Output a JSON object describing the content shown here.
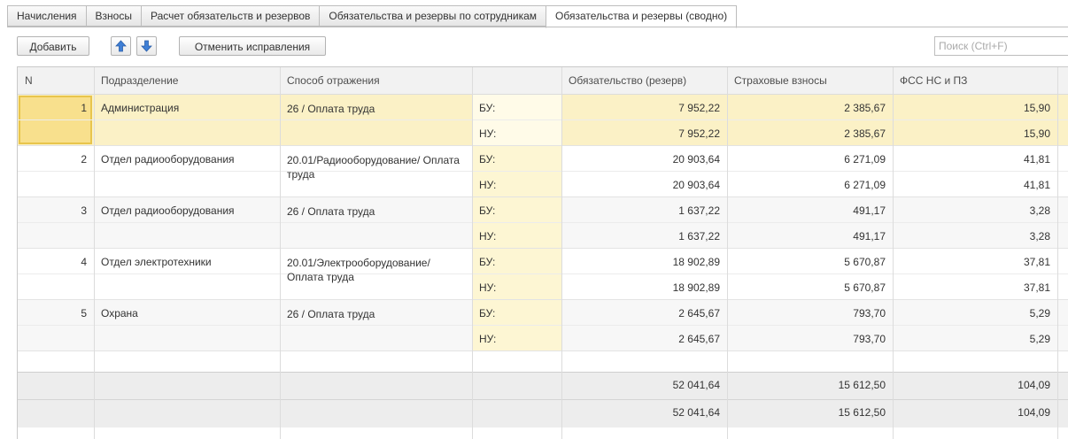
{
  "tabs": [
    {
      "label": "Начисления",
      "active": false
    },
    {
      "label": "Взносы",
      "active": false
    },
    {
      "label": "Расчет обязательств и резервов",
      "active": false
    },
    {
      "label": "Обязательства и резервы по сотрудникам",
      "active": false
    },
    {
      "label": "Обязательства и резервы (сводно)",
      "active": true
    }
  ],
  "toolbar": {
    "add_label": "Добавить",
    "cancel_label": "Отменить исправления",
    "up_icon": "arrow-up-icon",
    "down_icon": "arrow-down-icon"
  },
  "search": {
    "placeholder": "Поиск (Ctrl+F)",
    "value": ""
  },
  "table": {
    "headers": {
      "n": "N",
      "department": "Подразделение",
      "method": "Способ отражения",
      "type": "",
      "liability": "Обязательство (резерв)",
      "insurance": "Страховые взносы",
      "fss": "ФСС НС и ПЗ"
    },
    "rows": [
      {
        "n": "1",
        "department": "Администрация",
        "method": "26 / Оплата труда",
        "bu_label": "БУ:",
        "nu_label": "НУ:",
        "bu": {
          "liability": "7 952,22",
          "insurance": "2 385,67",
          "fss": "15,90"
        },
        "nu": {
          "liability": "7 952,22",
          "insurance": "2 385,67",
          "fss": "15,90"
        }
      },
      {
        "n": "2",
        "department": "Отдел радиооборудования",
        "method": "20.01/Радиооборудование/ Оплата труда",
        "bu_label": "БУ:",
        "nu_label": "НУ:",
        "bu": {
          "liability": "20 903,64",
          "insurance": "6 271,09",
          "fss": "41,81"
        },
        "nu": {
          "liability": "20 903,64",
          "insurance": "6 271,09",
          "fss": "41,81"
        }
      },
      {
        "n": "3",
        "department": "Отдел радиооборудования",
        "method": "26 / Оплата труда",
        "bu_label": "БУ:",
        "nu_label": "НУ:",
        "bu": {
          "liability": "1 637,22",
          "insurance": "491,17",
          "fss": "3,28"
        },
        "nu": {
          "liability": "1 637,22",
          "insurance": "491,17",
          "fss": "3,28"
        }
      },
      {
        "n": "4",
        "department": "Отдел электротехники",
        "method": "20.01/Электрооборудование/ Оплата труда",
        "bu_label": "БУ:",
        "nu_label": "НУ:",
        "bu": {
          "liability": "18 902,89",
          "insurance": "5 670,87",
          "fss": "37,81"
        },
        "nu": {
          "liability": "18 902,89",
          "insurance": "5 670,87",
          "fss": "37,81"
        }
      },
      {
        "n": "5",
        "department": "Охрана",
        "method": "26 / Оплата труда",
        "bu_label": "БУ:",
        "nu_label": "НУ:",
        "bu": {
          "liability": "2 645,67",
          "insurance": "793,70",
          "fss": "5,29"
        },
        "nu": {
          "liability": "2 645,67",
          "insurance": "793,70",
          "fss": "5,29"
        }
      }
    ],
    "totals": {
      "bu": {
        "liability": "52 041,64",
        "insurance": "15 612,50",
        "fss": "104,09"
      },
      "nu": {
        "liability": "52 041,64",
        "insurance": "15 612,50",
        "fss": "104,09"
      }
    }
  },
  "colors": {
    "selected_row": "#fbf1c6",
    "selected_cell": "#f8e08d",
    "type_column_bg": "#fdf6d3",
    "header_bg": "#f2f2f2",
    "footer_bg": "#ededed"
  }
}
